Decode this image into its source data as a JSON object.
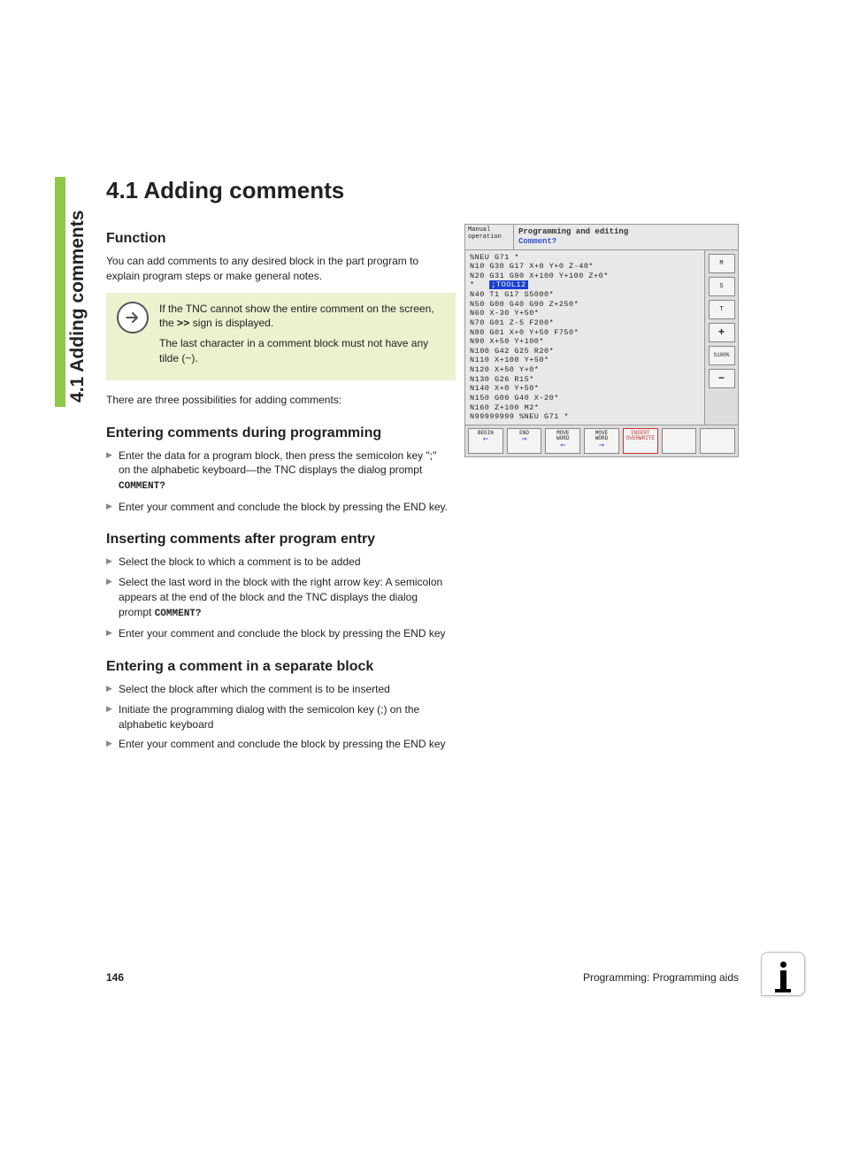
{
  "sidebar": {
    "label": "4.1 Adding comments"
  },
  "heading": "4.1  Adding comments",
  "sections": {
    "function": {
      "title": "Function",
      "intro": "You can add comments to any desired block in the part program to explain program steps or make general notes.",
      "note": {
        "p1a": "If the TNC cannot show the entire comment on the screen, the ",
        "p1b": ">>",
        "p1c": " sign is displayed.",
        "p2": "The last character in a comment block must not have any tilde (~)."
      },
      "after_note": "There are three possibilities for adding comments:"
    },
    "enter_prog": {
      "title": "Entering comments during programming",
      "items": [
        {
          "pre": "Enter the data for a program block, then press the semicolon key \";\" on the alphabetic keyboard—the TNC displays the dialog prompt ",
          "mono": "COMMENT?"
        },
        {
          "pre": "Enter your comment and conclude the block by pressing the END key."
        }
      ]
    },
    "insert_after": {
      "title": "Inserting comments after program entry",
      "items": [
        {
          "pre": "Select the block to which a comment is to be added"
        },
        {
          "pre": "Select the last word in the block with the right arrow key: A semicolon appears at the end of the block and the TNC displays the dialog prompt ",
          "mono": "COMMENT?"
        },
        {
          "pre": "Enter your comment and conclude the block by pressing the END key"
        }
      ]
    },
    "separate": {
      "title": "Entering a comment in a separate block",
      "items": [
        {
          "pre": "Select the block after which the comment is to be inserted"
        },
        {
          "pre": "Initiate the programming dialog with the semicolon key (;) on the alphabetic keyboard"
        },
        {
          "pre": "Enter your comment and conclude the block by pressing the END key"
        }
      ]
    }
  },
  "screenshot": {
    "header_left": "Manual\noperation",
    "header_l1": "Programming and editing",
    "header_l2": "Comment?",
    "code_before": "%NEU G71 *\nN10 G30 G17 X+0 Y+0 Z-40*\nN20 G31 G90 X+100 Y+100 Z+0*",
    "code_hl_prefix": "*   ",
    "code_hl": ";TOOL12",
    "code_after": "N40 T1 G17 S5000*\nN50 G00 G40 G90 Z+250*\nN60 X-30 Y+50*\nN70 G01 Z-5 F200*\nN80 G01 X+0 Y+50 F750*\nN90 X+50 Y+100*\nN100 G42 G25 R20*\nN110 X+100 Y+50*\nN120 X+50 Y+0*\nN130 G26 R15*\nN140 X+0 Y+50*\nN150 G00 G40 X-20*\nN160 Z+100 M2*\nN99999999 %NEU G71 *",
    "side_labels": [
      "M",
      "S",
      "T",
      "S100%",
      ""
    ],
    "footer_btns": [
      "BEGIN",
      "END",
      "MOVE\nWORD",
      "MOVE\nWORD",
      "INSERT\nOVERWRITE"
    ]
  },
  "footer": {
    "page": "146",
    "section": "Programming: Programming aids"
  }
}
